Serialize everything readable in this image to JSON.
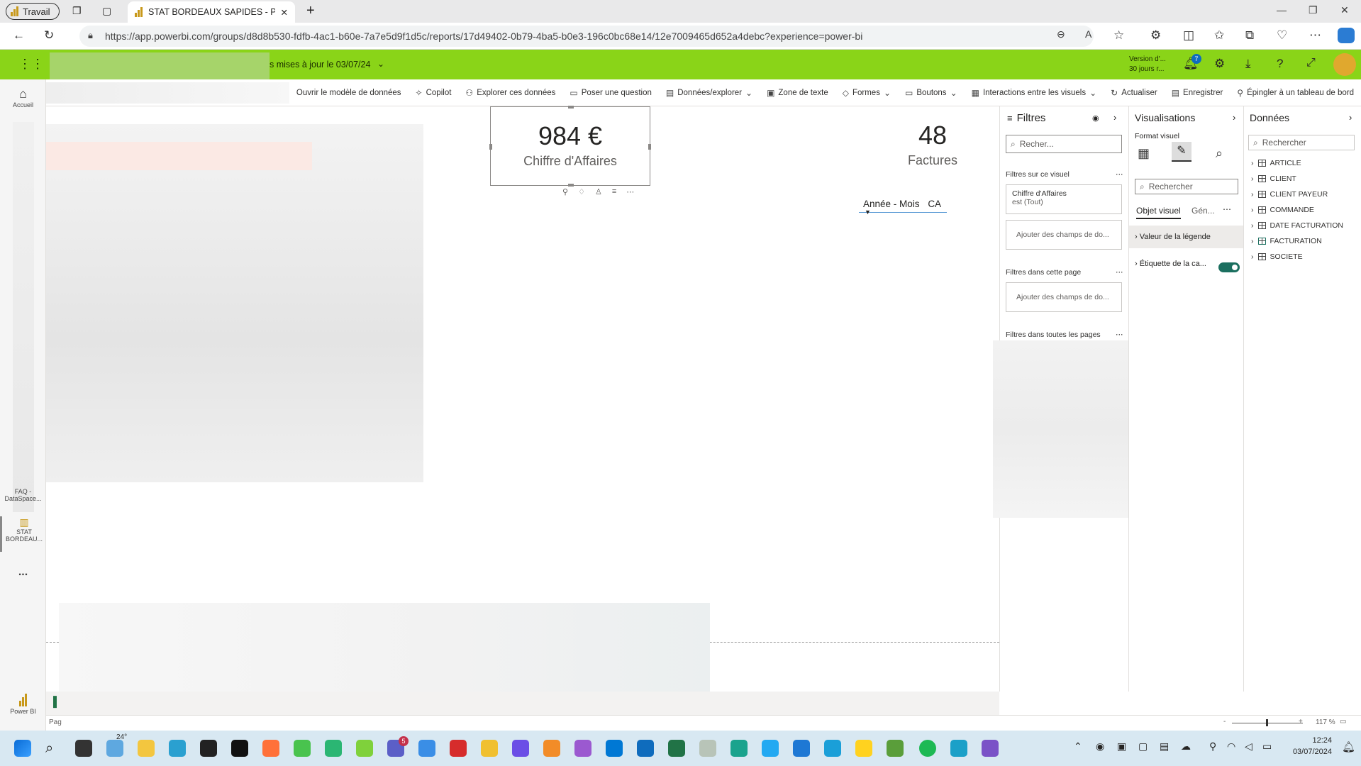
{
  "browser": {
    "profile_label": "Travail",
    "tab_title": "STAT BORDEAUX SAPIDES - Power BI",
    "url": "https://app.powerbi.com/groups/d8d8b530-fdfb-4ac1-b60e-7a7e5d9f1d5c/reports/17d49402-0b79-4ba5-b0e3-196c0bc68e14/12e7009465d652a4debc?experience=power-bi"
  },
  "header": {
    "report_status": "s mises à jour le 03/07/24",
    "version_line1": "Version d'...",
    "version_line2": "30 jours r...",
    "notification_count": "7"
  },
  "ribbon": {
    "items": [
      "Ouvrir le modèle de données",
      "Copilot",
      "Explorer ces données",
      "Poser une question",
      "Données/explorer",
      "Zone de texte",
      "Formes",
      "Boutons",
      "Interactions entre les visuels",
      "Actualiser",
      "Enregistrer",
      "Épingler à un tableau de bord"
    ]
  },
  "leftnav": {
    "home": "Accueil",
    "faq_line1": "FAQ -",
    "faq_line2": "DataSpace...",
    "stat_line1": "STAT",
    "stat_line2": "BORDEAU...",
    "more": "...",
    "powerbi": "Power BI"
  },
  "canvas": {
    "card1_value": "984 €",
    "card1_label": "Chiffre d'Affaires",
    "card2_value": "48",
    "card2_label": "Factures",
    "axis_field1": "Année - Mois",
    "axis_field2": "CA"
  },
  "filters": {
    "title": "Filtres",
    "search_placeholder": "Recher...",
    "on_visual": "Filtres sur ce visuel",
    "filter_field": "Chiffre d'Affaires",
    "filter_state": "est (Tout)",
    "add_fields": "Ajouter des champs de do...",
    "on_page": "Filtres dans cette page",
    "add_fields_page": "Ajouter des champs de do...",
    "all_pages": "Filtres dans toutes les pages"
  },
  "visualizations": {
    "title": "Visualisations",
    "format_label": "Format visuel",
    "search_placeholder": "Rechercher",
    "tab_visual": "Objet visuel",
    "tab_general": "Gén...",
    "section_legend": "Valeur de la légende",
    "section_category": "Étiquette de la ca..."
  },
  "data": {
    "title": "Données",
    "search_placeholder": "Rechercher",
    "tables": [
      "ARTICLE",
      "CLIENT",
      "CLIENT PAYEUR",
      "COMMANDE",
      "DATE FACTURATION",
      "FACTURATION",
      "SOCIETE"
    ]
  },
  "status": {
    "page_label": "Pag",
    "zoom": "117 %"
  },
  "taskbar": {
    "weather": "24°",
    "teams_badge": "5",
    "time": "12:24",
    "date": "03/07/2024"
  },
  "colors": {
    "pbi_header": "#8ad418",
    "accent_gold": "#c8991b",
    "toggle_on": "#1b6f5f"
  }
}
